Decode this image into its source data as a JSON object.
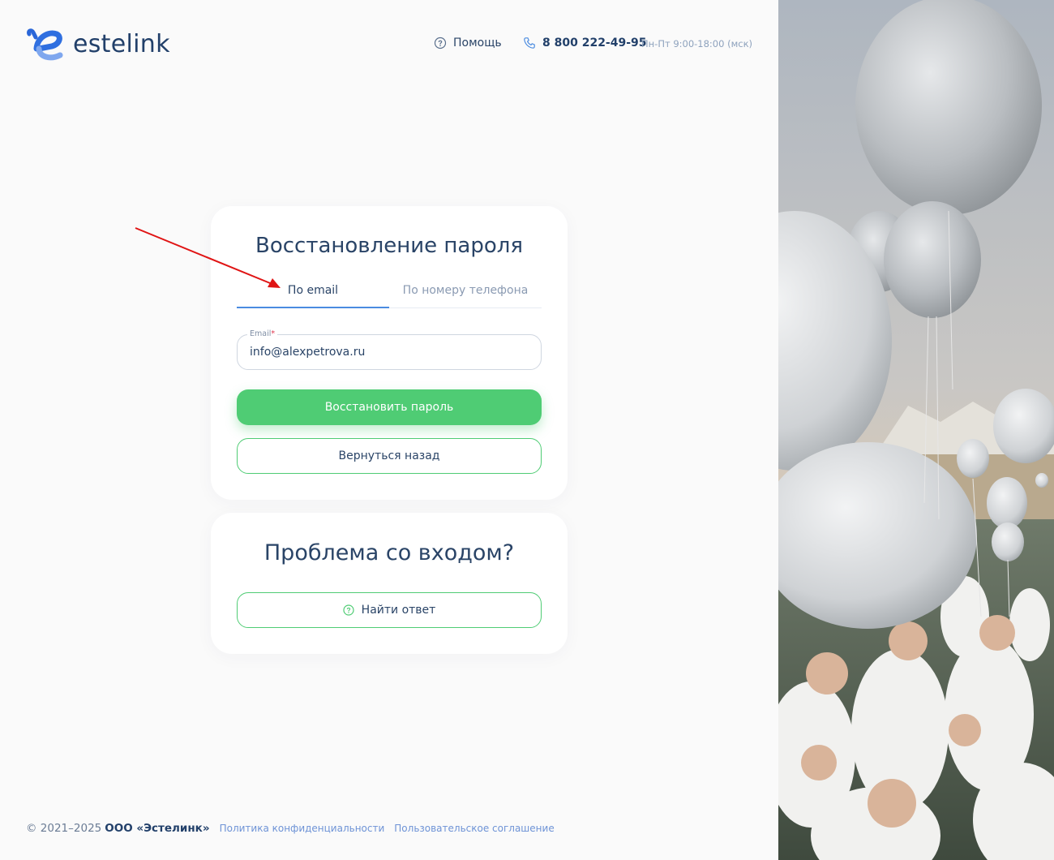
{
  "header": {
    "logo_text": "estelink",
    "help_label": "Помощь",
    "phone": "8 800 222-49-95",
    "hours": "Пн-Пт 9:00-18:00 (мск)"
  },
  "recovery": {
    "title": "Восстановление пароля",
    "tabs": [
      {
        "label": "По email",
        "active": true
      },
      {
        "label": "По номеру телефона",
        "active": false
      }
    ],
    "email_label": "Email",
    "email_required_mark": "*",
    "email_value": "info@alexpetrova.ru",
    "submit_label": "Восстановить пароль",
    "back_label": "Вернуться назад"
  },
  "problem": {
    "title": "Проблема со входом?",
    "find_label": "Найти ответ"
  },
  "footer": {
    "copyright": "© 2021–2025",
    "company": "ООО «Эстелинк»",
    "privacy_link": "Политика конфиденциальности",
    "terms_link": "Пользовательское соглашение"
  },
  "colors": {
    "primary_green": "#4fcc74",
    "text_dark_blue": "#2a4467",
    "accent_blue": "#4a8be0",
    "link_blue": "#6e93d6",
    "annotation_red": "#e01414"
  },
  "icons": [
    "logo-mark-icon",
    "help-circle-icon",
    "phone-icon",
    "question-circle-icon",
    "annotation-arrow"
  ]
}
